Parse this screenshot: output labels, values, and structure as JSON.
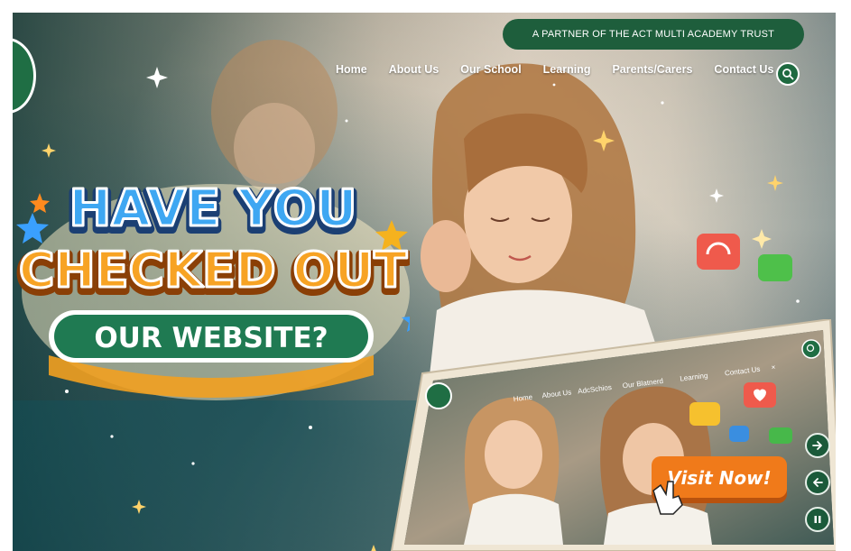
{
  "banner": {
    "partner_text": "A PARTNER OF THE ACT MULTI ACADEMY TRUST"
  },
  "nav": {
    "items": [
      {
        "label": "Home",
        "name": "nav-home"
      },
      {
        "label": "About Us",
        "name": "nav-about-us"
      },
      {
        "label": "Our School",
        "name": "nav-our-school"
      },
      {
        "label": "Learning",
        "name": "nav-learning"
      },
      {
        "label": "Parents/Carers",
        "name": "nav-parents-carers"
      },
      {
        "label": "Contact Us",
        "name": "nav-contact-us"
      }
    ],
    "search_icon": "search-icon"
  },
  "hero": {
    "line1": "HAVE YOU",
    "line2": "CHECKED OUT",
    "line3": "OUR WEBSITE?"
  },
  "laptop_screen": {
    "nav_items": [
      "Home",
      "About Us",
      "AdcSchios",
      "Our Blatnerd",
      "Learning",
      "Contact Us"
    ],
    "close_glyph": "×",
    "visit_label": "Visit Now!"
  },
  "controls": {
    "next_icon": "arrow-right-icon",
    "prev_icon": "arrow-left-icon",
    "pause_icon": "pause-icon"
  },
  "colors": {
    "brand_green": "#1e5e3c",
    "headline_blue": "#2e8fd6",
    "headline_orange": "#f59a1c",
    "badge_green": "#1f7a52",
    "visit_orange": "#f07a1a"
  }
}
